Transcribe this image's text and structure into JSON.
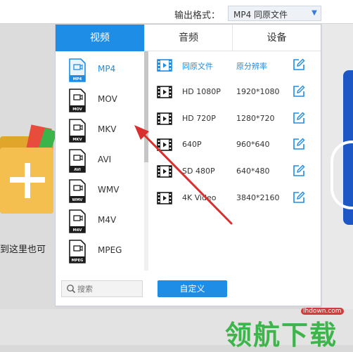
{
  "header": {
    "format_label": "输出格式：",
    "format_value": "MP4  同原文件"
  },
  "background": {
    "drop_hint": "到这里也可"
  },
  "popup": {
    "tabs": [
      {
        "label": "视频",
        "active": true
      },
      {
        "label": "音频",
        "active": false
      },
      {
        "label": "设备",
        "active": false
      }
    ],
    "formats": [
      {
        "name": "MP4",
        "tag": "MP4",
        "selected": true
      },
      {
        "name": "MOV",
        "tag": "MOV",
        "selected": false
      },
      {
        "name": "MKV",
        "tag": "MKV",
        "selected": false
      },
      {
        "name": "AVI",
        "tag": "AVI",
        "selected": false
      },
      {
        "name": "WMV",
        "tag": "WMV",
        "selected": false
      },
      {
        "name": "M4V",
        "tag": "M4V",
        "selected": false
      },
      {
        "name": "MPEG",
        "tag": "MPEG",
        "selected": false
      }
    ],
    "presets": [
      {
        "name": "同原文件",
        "resolution": "原分辨率",
        "selected": true
      },
      {
        "name": "HD 1080P",
        "resolution": "1920*1080",
        "selected": false
      },
      {
        "name": "HD 720P",
        "resolution": "1280*720",
        "selected": false
      },
      {
        "name": "640P",
        "resolution": "960*640",
        "selected": false
      },
      {
        "name": "SD 480P",
        "resolution": "640*480",
        "selected": false
      },
      {
        "name": "4K Video",
        "resolution": "3840*2160",
        "selected": false
      }
    ],
    "search_placeholder": "搜索",
    "custom_button": "自定义"
  },
  "watermark": {
    "url": "lhdown.com",
    "text": "领航下载"
  },
  "colors": {
    "accent": "#1e8de6",
    "annotation": "#d9302f",
    "watermark_green": "#3db54a"
  }
}
